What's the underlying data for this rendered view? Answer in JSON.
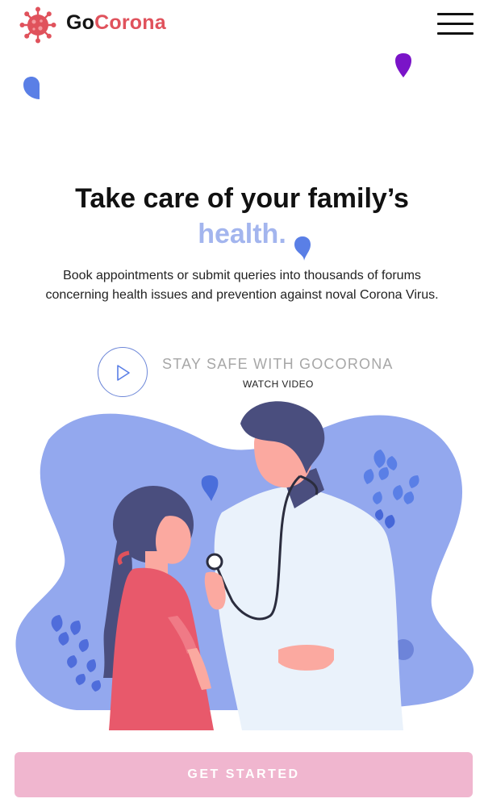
{
  "brand": {
    "prefix": "Go",
    "suffix": "Corona"
  },
  "hero": {
    "headline": "Take care of your family’s",
    "highlight": "health.",
    "description": "Book appointments or submit queries into thousands of forums concerning health issues and prevention against noval Corona Virus."
  },
  "video": {
    "title": "STAY SAFE WITH GOCORONA",
    "link_label": "WATCH VIDEO"
  },
  "cta": {
    "label": "GET STARTED"
  },
  "icons": {
    "logo": "virus-icon",
    "menu": "hamburger-menu-icon",
    "play": "play-icon"
  },
  "colors": {
    "brand_red": "#e0525c",
    "highlight_blue": "#a3b5ee",
    "illustration_blob": "#93a8ee",
    "cta_pink": "#f0b6cf",
    "drop_blue": "#5a7fe6",
    "drop_purple": "#7a14c8"
  }
}
